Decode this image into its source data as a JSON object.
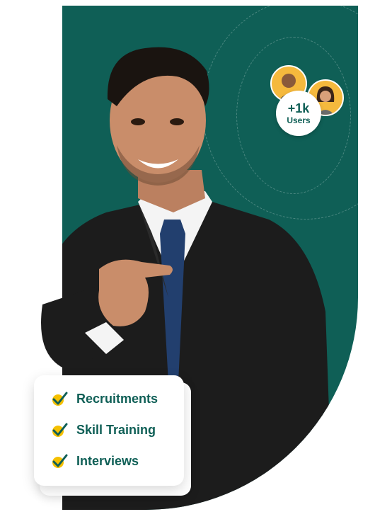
{
  "users": {
    "count": "+1k",
    "label": "Users"
  },
  "features": [
    {
      "label": "Recruitments",
      "icon": "check-icon"
    },
    {
      "label": "Skill Training",
      "icon": "check-icon"
    },
    {
      "label": "Interviews",
      "icon": "check-icon"
    }
  ],
  "colors": {
    "primary": "#0f5f56",
    "accent": "#f5c000",
    "avatar_bg": "#f5b93d"
  }
}
